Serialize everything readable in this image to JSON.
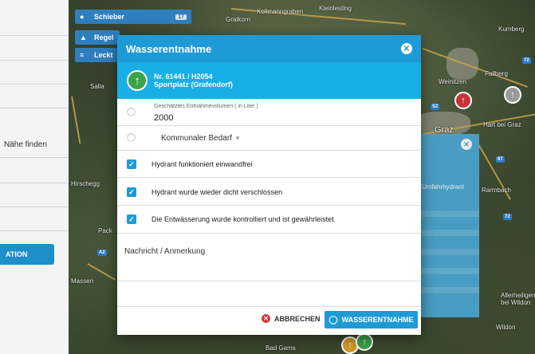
{
  "colors": {
    "accent": "#1e9ad6",
    "header": "#1e9ad6",
    "hydrant_bar": "#19aee6",
    "hydrant_green": "#3aa44b",
    "cancel_red": "#d23a3a"
  },
  "left_panel": {
    "near_text": "Nähe finden",
    "button_label": "ATION"
  },
  "layer_chips": [
    {
      "label": "Schieber",
      "icon": "drop-icon",
      "count": "17"
    },
    {
      "label": "Regel",
      "icon": "regulator-icon",
      "count": ""
    },
    {
      "label": "Leckt",
      "icon": "leak-icon",
      "count": ""
    }
  ],
  "map_labels": [
    "Gratkorn",
    "Kollmanngraben",
    "Kleinlesting",
    "Weinitzen",
    "Fallberg",
    "Graz",
    "Hart bei Graz",
    "Kumberg",
    "Hirschegg",
    "Salla",
    "Pack",
    "Bad Gams",
    "Wildon",
    "Allerheiligen bei Wildon",
    "Rarmbach",
    "Massen"
  ],
  "side_panel": {
    "title": "Umfahrhydrant"
  },
  "modal": {
    "title": "Wasserentnahme",
    "hydrant_number": "Nr. 61441 / H2054",
    "hydrant_location": "Sportplatz (Grafendorf)",
    "volume_label": "Geschätztes Entnahmevolumen ( in Liter )",
    "volume_value": "2000",
    "bedarf_value": "Kommunaler Bedarf",
    "checks": [
      "Hydrant funktioniert einwandfrei",
      "Hydrant wurde wieder dicht verschlossen",
      "Die Entwässerung wurde kontrolliert und ist gewährleistet"
    ],
    "note_label": "Nachricht / Anmerkung",
    "cancel_label": "ABBRECHEN",
    "submit_label": "WASSERENTNAHME"
  }
}
